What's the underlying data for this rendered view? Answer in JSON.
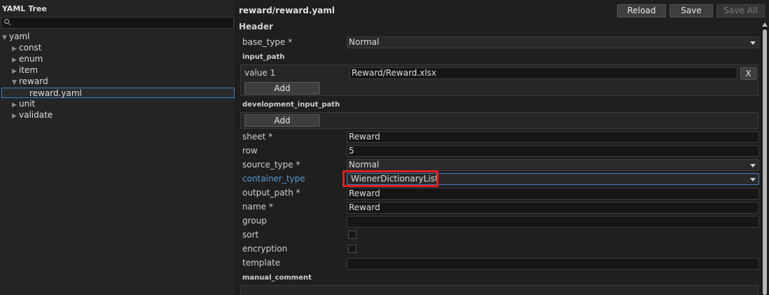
{
  "left_panel": {
    "title": "YAML Tree",
    "search_placeholder": "",
    "tree": [
      {
        "label": "yaml",
        "arrow": "▼"
      },
      {
        "label": "const",
        "arrow": "▶"
      },
      {
        "label": "enum",
        "arrow": "▶"
      },
      {
        "label": "item",
        "arrow": "▶"
      },
      {
        "label": "reward",
        "arrow": "▼"
      },
      {
        "label": "reward.yaml",
        "arrow": ""
      },
      {
        "label": "unit",
        "arrow": "▶"
      },
      {
        "label": "validate",
        "arrow": "▶"
      }
    ]
  },
  "toolbar": {
    "file_path": "reward/reward.yaml",
    "reload": "Reload",
    "save": "Save",
    "save_all": "Save All"
  },
  "form": {
    "section": "Header",
    "base_type": {
      "label": "base_type *",
      "value": "Normal"
    },
    "input_path": {
      "label": "input_path",
      "item_label": "value 1",
      "item_value": "Reward/Reward.xlsx",
      "remove": "X",
      "add": "Add"
    },
    "development_input_path": {
      "label": "development_input_path",
      "add": "Add"
    },
    "sheet": {
      "label": "sheet *",
      "value": "Reward"
    },
    "row": {
      "label": "row",
      "value": "5"
    },
    "source_type": {
      "label": "source_type *",
      "value": "Normal"
    },
    "container_type": {
      "label": "container_type",
      "value": "WienerDictionaryList"
    },
    "output_path": {
      "label": "output_path *",
      "value": "Reward"
    },
    "name": {
      "label": "name *",
      "value": "Reward"
    },
    "group": {
      "label": "group",
      "value": ""
    },
    "sort": {
      "label": "sort",
      "checked": false
    },
    "encryption": {
      "label": "encryption",
      "checked": false
    },
    "template": {
      "label": "template",
      "value": ""
    },
    "manual_comment": {
      "label": "manual_comment"
    }
  },
  "colors": {
    "accent": "#3b7cc4",
    "highlight": "#e0201c",
    "link": "#5b9bd5"
  }
}
